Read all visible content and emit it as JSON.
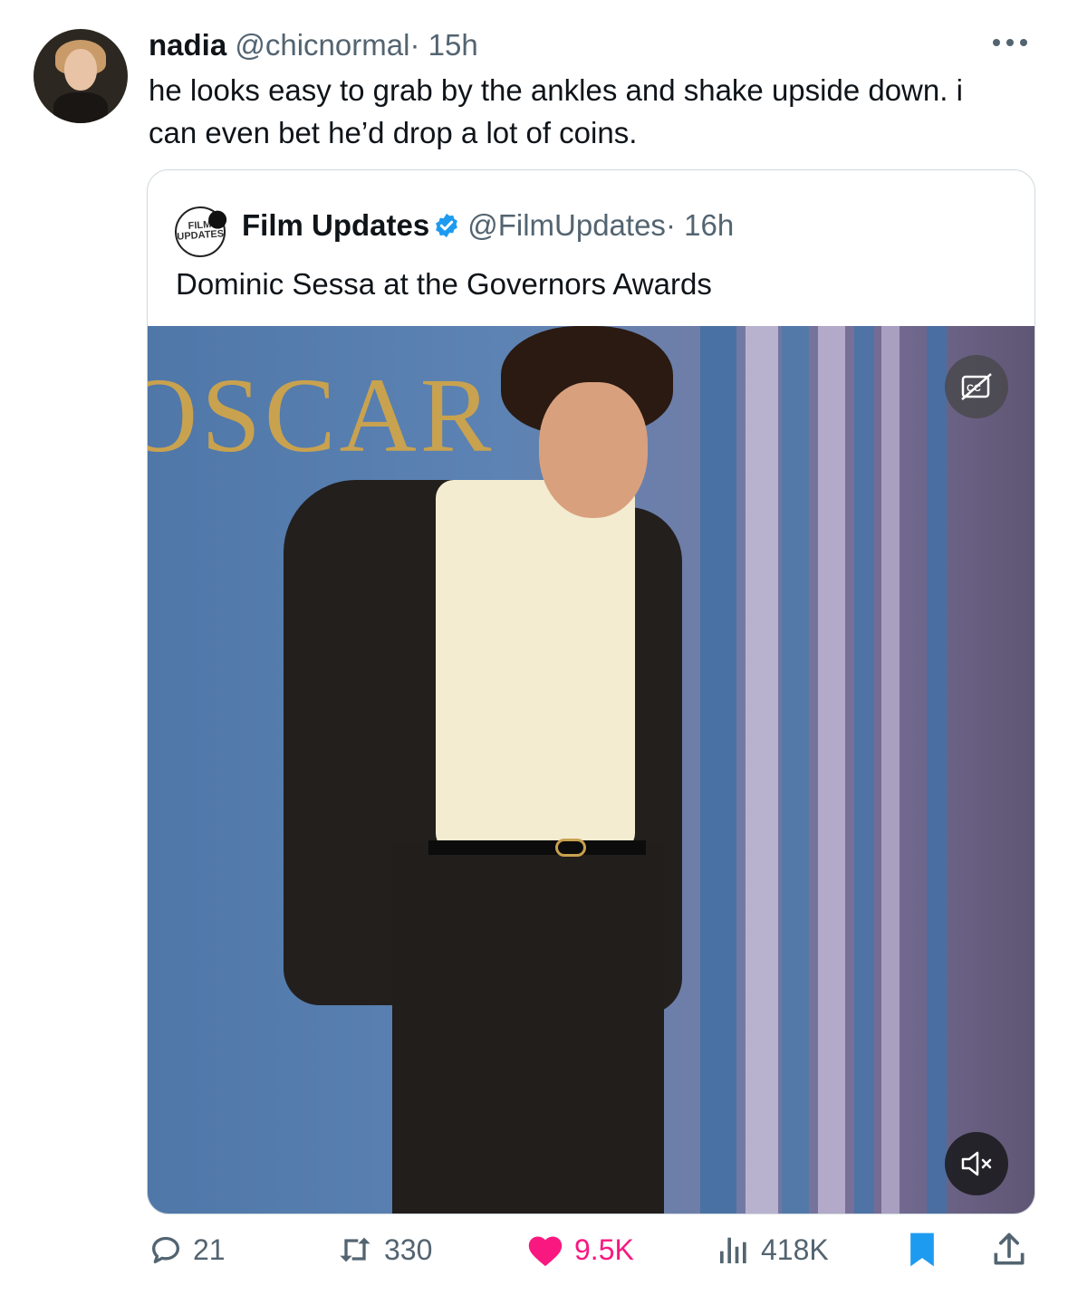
{
  "tweet": {
    "author_name": "nadia",
    "author_handle": "@chicnormal",
    "separator": "·",
    "time": "15h",
    "text": "he looks easy to grab by the ankles and shake upside down. i can even bet he’d drop a lot of coins.",
    "more_icon": "more-horizontal-icon"
  },
  "quoted": {
    "logo_text": "FILM UPDATES",
    "author_name": "Film Updates",
    "author_handle": "@FilmUpdates",
    "separator": "·",
    "time": "16h",
    "text": "Dominic Sessa at the Governors Awards",
    "media_overlay_text": "OSCAR",
    "cc_label": "CC",
    "verified_color": "#1d9bf0"
  },
  "actions": {
    "replies": "21",
    "reposts": "330",
    "likes": "9.5K",
    "views": "418K",
    "like_color": "#f91880",
    "bookmark_color": "#1d9bf0",
    "repost_color": "#536471"
  }
}
